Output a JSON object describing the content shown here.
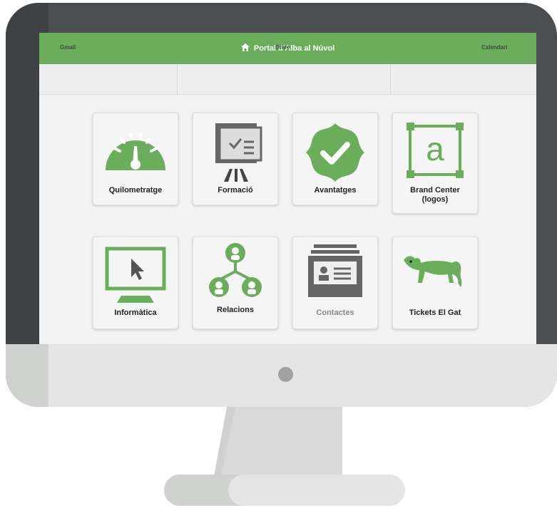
{
  "header": {
    "title": "Portal d'Alba al Núvol",
    "icon": "home-icon"
  },
  "quick_links": [
    {
      "label": "Gmail",
      "icon": "gmail-icon"
    },
    {
      "label": "Drive",
      "icon": "drive-icon"
    },
    {
      "label": "Calendari",
      "icon": "calendar-icon"
    }
  ],
  "tiles": [
    {
      "label": "Quilometratge",
      "icon": "speedometer-icon"
    },
    {
      "label": "Formació",
      "icon": "presentation-board-icon"
    },
    {
      "label": "Avantatges",
      "icon": "verified-badge-icon"
    },
    {
      "label": "Brand Center\n(logos)",
      "icon": "logo-frame-icon"
    },
    {
      "label": "Informàtica",
      "icon": "monitor-cursor-icon"
    },
    {
      "label": "Relacions",
      "icon": "people-network-icon"
    },
    {
      "label": "Contactes",
      "icon": "contact-cards-icon"
    },
    {
      "label": "Tickets El Gat",
      "icon": "cat-icon"
    }
  ],
  "colors": {
    "accent": "#6aae5b",
    "monitor": "#4b4e51",
    "chin": "#e4e5e4"
  }
}
